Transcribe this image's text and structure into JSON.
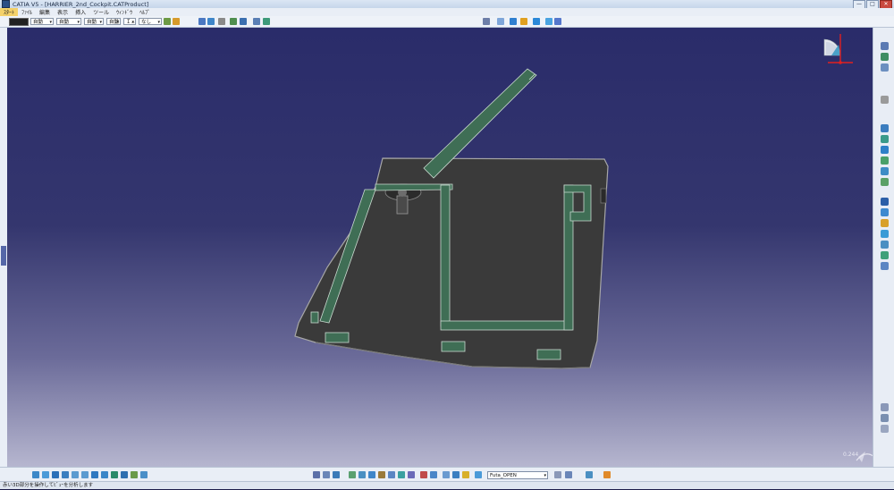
{
  "window": {
    "title": "CATIA V5 - [HARRIER_2nd_Cockpit.CATProduct]",
    "controls": [
      "—",
      "□",
      "✕"
    ]
  },
  "menu": {
    "items": [
      {
        "label": "ｽﾀｰﾄ",
        "active": true
      },
      {
        "label": "ﾌｧｲﾙ"
      },
      {
        "label": "編集"
      },
      {
        "label": "表示"
      },
      {
        "label": "挿入"
      },
      {
        "label": "ツール"
      },
      {
        "label": "ｳｨﾝﾄﾞｳ"
      },
      {
        "label": "ﾍﾙﾌﾟ"
      }
    ]
  },
  "toolbar": {
    "color_swatch": "#1e1e1e",
    "selects": [
      "自動",
      "自動",
      "自動",
      "自動",
      "Ｉ…",
      "なし"
    ]
  },
  "bottombar": {
    "layer_combo": "Futa_OPEN"
  },
  "viewport": {
    "zoom_label": "0.244"
  },
  "status": {
    "text": "赤い3D部分を操作してﾋﾞｭｰを分析します"
  },
  "colors": {
    "viewport_top": "#2a2c6a",
    "part_dark": "#3a3a3a",
    "part_green": "#3f6e55",
    "accent_red": "#e02020"
  }
}
